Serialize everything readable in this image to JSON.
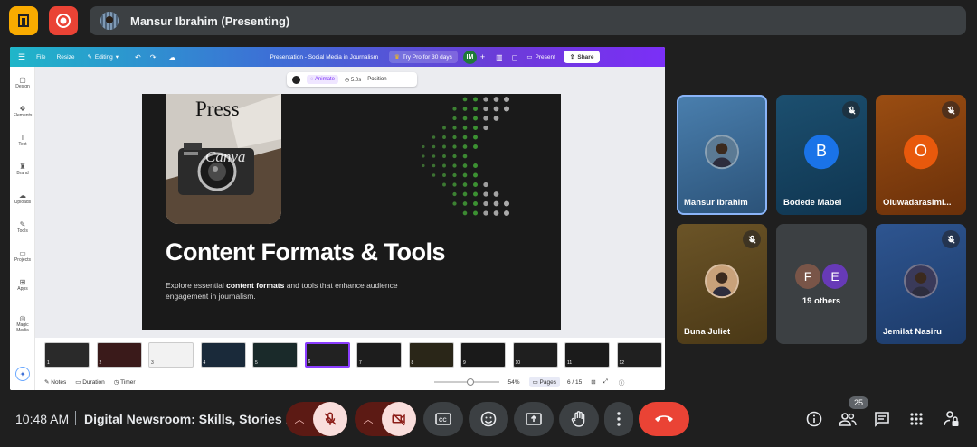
{
  "presenter": {
    "name": "Mansur Ibrahim (Presenting)"
  },
  "canva": {
    "menu": {
      "file": "File",
      "resize": "Resize",
      "editing": "Editing"
    },
    "doc_title": "Presentation - Social Media in Journalism",
    "try_pro": "Try Pro for 30 days",
    "user_initials": "IM",
    "present": "Present",
    "share": "Share",
    "sidebar": [
      "Design",
      "Elements",
      "Text",
      "Brand",
      "Uploads",
      "Tools",
      "Projects",
      "Apps",
      "Magic Media"
    ],
    "float_toolbar": {
      "animate": "Animate",
      "duration": "5.0s",
      "position": "Position"
    },
    "slide": {
      "title": "Content Formats & Tools",
      "sub_pre": "Explore essential ",
      "sub_bold": "content formats",
      "sub_post": " and tools that enhance audience engagement in journalism.",
      "photo_text_1": "Press",
      "photo_text_2": "Canva"
    },
    "thumbnails": [
      "1",
      "2",
      "3",
      "4",
      "5",
      "6",
      "7",
      "8",
      "9",
      "10",
      "11",
      "12"
    ],
    "active_thumbnail": 6,
    "bottom": {
      "notes": "Notes",
      "duration": "Duration",
      "timer": "Timer",
      "zoom": "54%",
      "pages_label": "Pages",
      "page_counter": "6 / 15"
    }
  },
  "participants": [
    {
      "name": "Mansur Ibrahim",
      "initial": "",
      "color": "#3a6a95",
      "muted": false
    },
    {
      "name": "Bodede Mabel",
      "initial": "B",
      "color": "#1a73e8",
      "muted": true
    },
    {
      "name": "Oluwadarasimi...",
      "initial": "O",
      "color": "#e8590c",
      "muted": true
    },
    {
      "name": "Buna Juliet",
      "initial": "",
      "color": "#8a6a35",
      "muted": true
    },
    {
      "name": "19 others",
      "initial": "",
      "color": "#3c4043",
      "muted": false
    },
    {
      "name": "Jemilat Nasiru",
      "initial": "",
      "color": "#2a4f83",
      "muted": true
    }
  ],
  "others_initials": [
    "F",
    "E"
  ],
  "bottom_bar": {
    "time": "10:48 AM",
    "meeting_title": "Digital Newsroom: Skills, Stories ...",
    "people_count": "25"
  }
}
